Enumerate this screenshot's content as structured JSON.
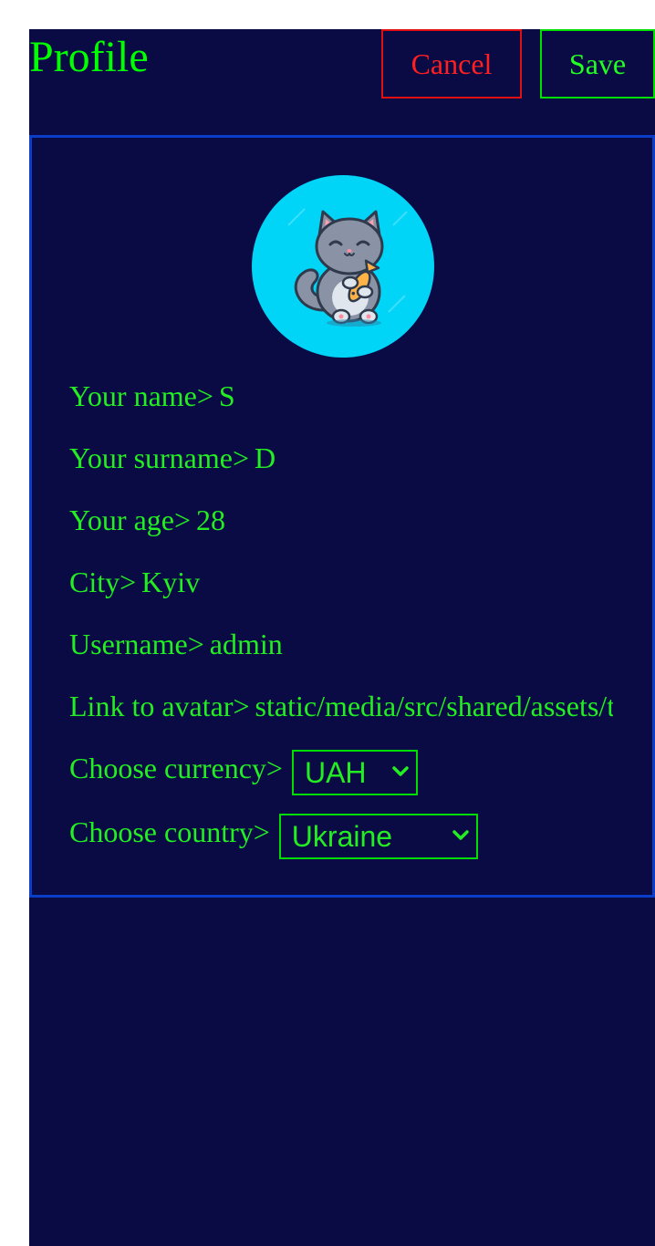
{
  "header": {
    "title": "Profile",
    "cancel_label": "Cancel",
    "save_label": "Save"
  },
  "profile": {
    "avatar_icon": "cat-holding-fish-avatar",
    "fields": [
      {
        "label": "Your name>",
        "value": "S"
      },
      {
        "label": "Your surname>",
        "value": "D"
      },
      {
        "label": "Your age>",
        "value": "28"
      },
      {
        "label": "City>",
        "value": "Kyiv"
      },
      {
        "label": "Username>",
        "value": "admin"
      },
      {
        "label": "Link to avatar>",
        "value": "static/media/src/shared/assets/t"
      }
    ],
    "currency": {
      "label": "Choose currency>",
      "selected": "UAH"
    },
    "country": {
      "label": "Choose country>",
      "selected": "Ukraine"
    }
  },
  "colors": {
    "background": "#0a0a45",
    "text": "#22ee22",
    "cancel": "#ff2020",
    "card_border": "#0b3ec8",
    "avatar_bg": "#00d4f7"
  }
}
